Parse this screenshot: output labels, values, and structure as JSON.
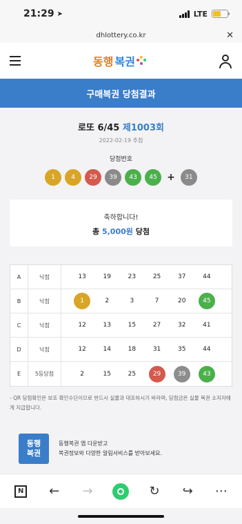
{
  "status": {
    "time": "21:29",
    "network": "LTE"
  },
  "browser": {
    "url": "dhlottery.co.kr"
  },
  "header": {
    "logo_a": "동행",
    "logo_b": "복권"
  },
  "page_title": "구매복권 당첨결과",
  "draw": {
    "game": "로또 6/45",
    "round": "제1003회",
    "date": "2022-02-19 추첨",
    "label": "당첨번호"
  },
  "winning_numbers": [
    "1",
    "4",
    "29",
    "39",
    "43",
    "45"
  ],
  "bonus_number": "31",
  "result": {
    "line1": "축하합니다!",
    "prefix": "총 ",
    "amount": "5,000원",
    "suffix": " 당첨"
  },
  "tickets": [
    {
      "letter": "A",
      "status": "낙첨",
      "numbers": [
        "13",
        "19",
        "23",
        "25",
        "37",
        "44"
      ],
      "hits": [
        null,
        null,
        null,
        null,
        null,
        null
      ]
    },
    {
      "letter": "B",
      "status": "낙첨",
      "numbers": [
        "1",
        "2",
        "3",
        "7",
        "20",
        "45"
      ],
      "hits": [
        "y",
        null,
        null,
        null,
        null,
        "gr"
      ]
    },
    {
      "letter": "C",
      "status": "낙첨",
      "numbers": [
        "12",
        "13",
        "15",
        "27",
        "32",
        "41"
      ],
      "hits": [
        null,
        null,
        null,
        null,
        null,
        null
      ]
    },
    {
      "letter": "D",
      "status": "낙첨",
      "numbers": [
        "12",
        "14",
        "18",
        "31",
        "35",
        "44"
      ],
      "hits": [
        null,
        null,
        null,
        null,
        null,
        null
      ]
    },
    {
      "letter": "E",
      "status": "5등당첨",
      "numbers": [
        "2",
        "15",
        "25",
        "29",
        "39",
        "43"
      ],
      "hits": [
        null,
        null,
        null,
        "r",
        "gy",
        "gr"
      ]
    }
  ],
  "notice": "- QR 당첨확인은 보조 확인수단이므로 반드시 실물과 대조하시기 바라며, 당첨금은 실물 복권 소지자에게 지급합니다.",
  "banner": {
    "icon_text": "동행\n복권",
    "line1": "동행복권 앱 다운받고",
    "line2": "복권정보와 다양한 알림서비스를 받아보세요."
  },
  "colors": {
    "accent": "#3a7dc9",
    "ball_yellow": "#d9a527",
    "ball_red": "#d35a4c",
    "ball_gray": "#8a8a8a",
    "ball_green": "#4bb04b"
  }
}
